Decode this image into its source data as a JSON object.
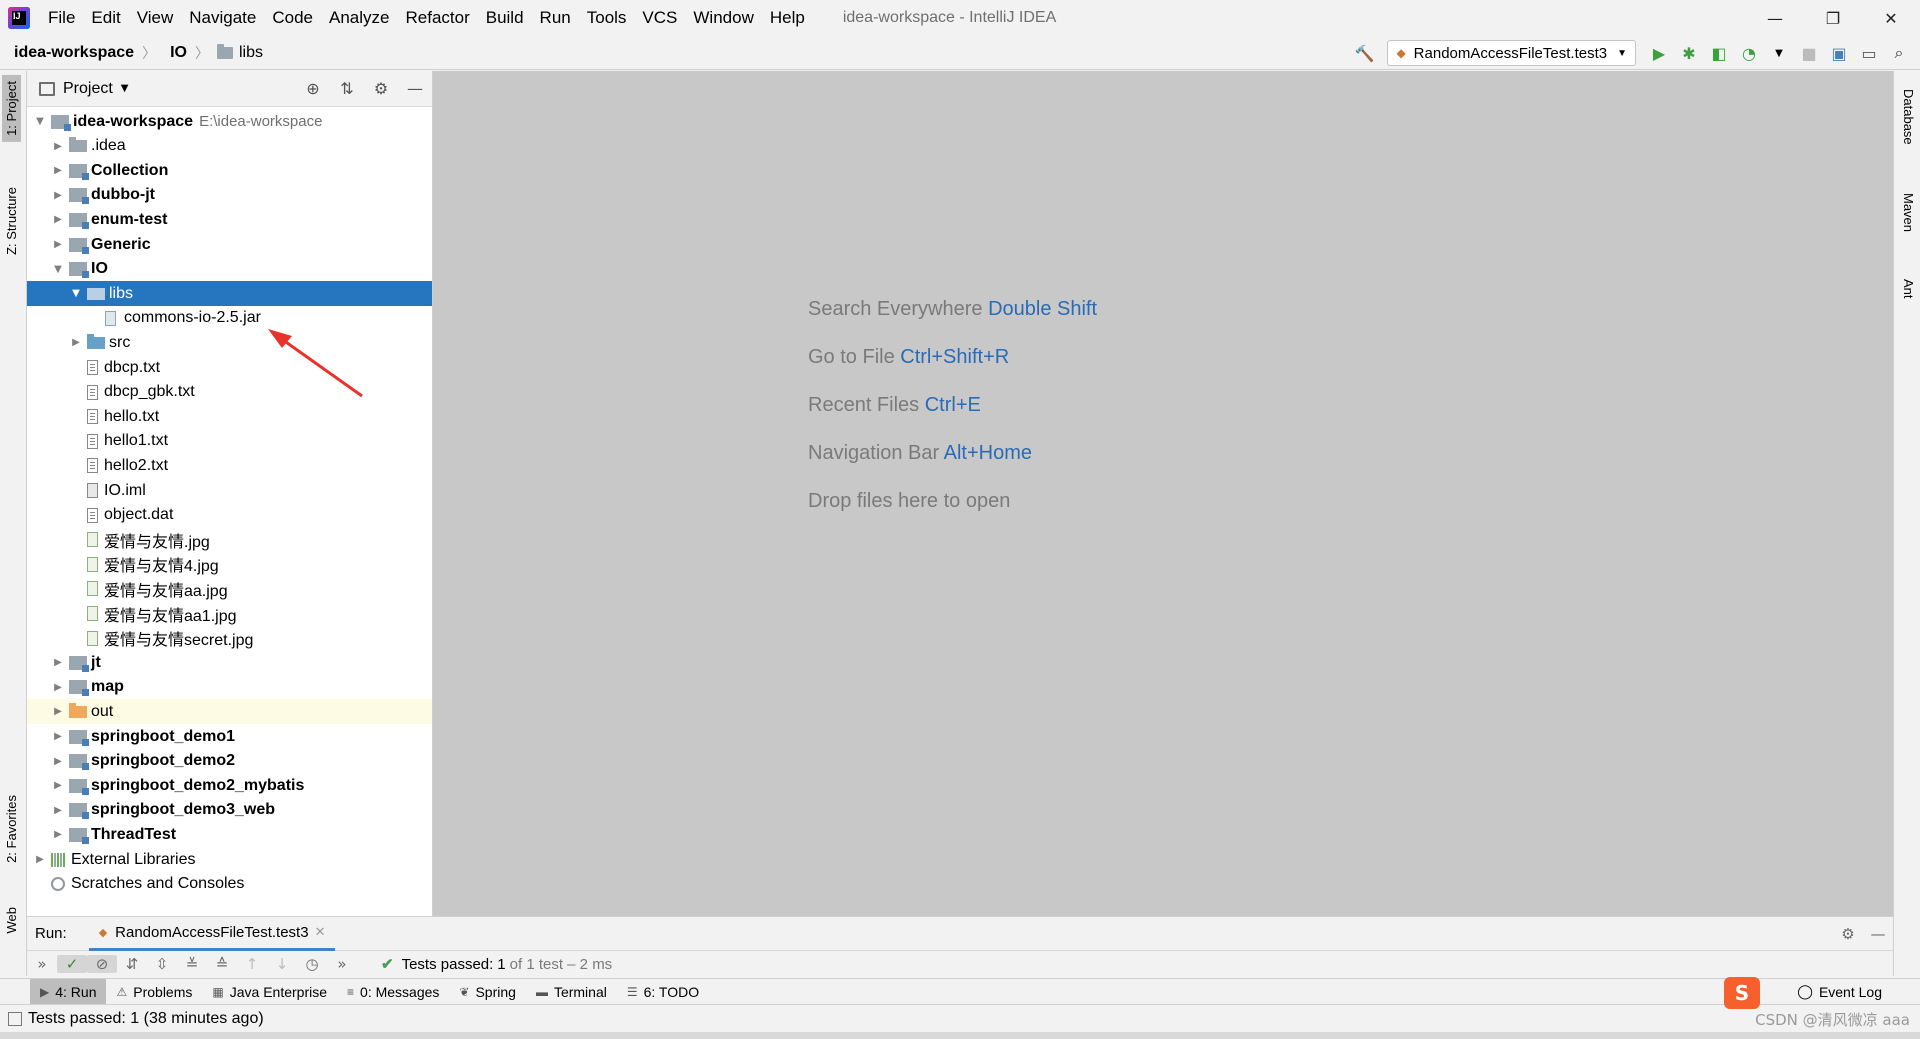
{
  "app": {
    "window_title": "idea-workspace - IntelliJ IDEA",
    "logo_text": "IJ"
  },
  "menu": [
    "File",
    "Edit",
    "View",
    "Navigate",
    "Code",
    "Analyze",
    "Refactor",
    "Build",
    "Run",
    "Tools",
    "VCS",
    "Window",
    "Help"
  ],
  "window_controls": {
    "minimize": "—",
    "maximize": "❐",
    "close": "✕"
  },
  "breadcrumb": {
    "project": "idea-workspace",
    "module": "IO",
    "folder": "libs"
  },
  "run_config": {
    "name": "RandomAccessFileTest.test3"
  },
  "left_stripe": {
    "project_tab": "1: Project",
    "structure_tab": "Z: Structure",
    "favorites_tab": "2: Favorites",
    "web_tab": "Web"
  },
  "right_stripe": {
    "database_tab": "Database",
    "maven_tab": "Maven",
    "ant_tab": "Ant"
  },
  "project_panel": {
    "title": "Project",
    "tree": [
      {
        "label": "idea-workspace",
        "path": "E:\\idea-workspace",
        "type": "module",
        "depth": 0,
        "arrow": "▼",
        "bold": true
      },
      {
        "label": ".idea",
        "type": "folder",
        "depth": 1,
        "arrow": "▶",
        "bold": false
      },
      {
        "label": "Collection",
        "type": "module",
        "depth": 1,
        "arrow": "▶",
        "bold": true
      },
      {
        "label": "dubbo-jt",
        "type": "module",
        "depth": 1,
        "arrow": "▶",
        "bold": true
      },
      {
        "label": "enum-test",
        "type": "module",
        "depth": 1,
        "arrow": "▶",
        "bold": true
      },
      {
        "label": "Generic",
        "type": "module",
        "depth": 1,
        "arrow": "▶",
        "bold": true
      },
      {
        "label": "IO",
        "type": "module",
        "depth": 1,
        "arrow": "▼",
        "bold": true
      },
      {
        "label": "libs",
        "type": "folder-libs",
        "depth": 2,
        "arrow": "▼",
        "bold": false,
        "selected": true
      },
      {
        "label": "commons-io-2.5.jar",
        "type": "jar",
        "depth": 3,
        "arrow": "",
        "bold": false
      },
      {
        "label": "src",
        "type": "folder-src",
        "depth": 2,
        "arrow": "▶",
        "bold": false
      },
      {
        "label": "dbcp.txt",
        "type": "file",
        "depth": 2,
        "arrow": "",
        "bold": false
      },
      {
        "label": "dbcp_gbk.txt",
        "type": "file",
        "depth": 2,
        "arrow": "",
        "bold": false
      },
      {
        "label": "hello.txt",
        "type": "file",
        "depth": 2,
        "arrow": "",
        "bold": false
      },
      {
        "label": "hello1.txt",
        "type": "file",
        "depth": 2,
        "arrow": "",
        "bold": false
      },
      {
        "label": "hello2.txt",
        "type": "file",
        "depth": 2,
        "arrow": "",
        "bold": false
      },
      {
        "label": "IO.iml",
        "type": "iml",
        "depth": 2,
        "arrow": "",
        "bold": false
      },
      {
        "label": "object.dat",
        "type": "file",
        "depth": 2,
        "arrow": "",
        "bold": false
      },
      {
        "label": "爱情与友情.jpg",
        "type": "img",
        "depth": 2,
        "arrow": "",
        "bold": false
      },
      {
        "label": "爱情与友情4.jpg",
        "type": "img",
        "depth": 2,
        "arrow": "",
        "bold": false
      },
      {
        "label": "爱情与友情aa.jpg",
        "type": "img",
        "depth": 2,
        "arrow": "",
        "bold": false
      },
      {
        "label": "爱情与友情aa1.jpg",
        "type": "img",
        "depth": 2,
        "arrow": "",
        "bold": false
      },
      {
        "label": "爱情与友情secret.jpg",
        "type": "img",
        "depth": 2,
        "arrow": "",
        "bold": false
      },
      {
        "label": "jt",
        "type": "module",
        "depth": 1,
        "arrow": "▶",
        "bold": true
      },
      {
        "label": "map",
        "type": "module",
        "depth": 1,
        "arrow": "▶",
        "bold": true
      },
      {
        "label": "out",
        "type": "folder-out",
        "depth": 1,
        "arrow": "▶",
        "bold": false,
        "yellow": true
      },
      {
        "label": "springboot_demo1",
        "type": "module",
        "depth": 1,
        "arrow": "▶",
        "bold": true
      },
      {
        "label": "springboot_demo2",
        "type": "module",
        "depth": 1,
        "arrow": "▶",
        "bold": true
      },
      {
        "label": "springboot_demo2_mybatis",
        "type": "module",
        "depth": 1,
        "arrow": "▶",
        "bold": true
      },
      {
        "label": "springboot_demo3_web",
        "type": "module",
        "depth": 1,
        "arrow": "▶",
        "bold": true
      },
      {
        "label": "ThreadTest",
        "type": "module",
        "depth": 1,
        "arrow": "▶",
        "bold": true
      },
      {
        "label": "External Libraries",
        "type": "lib",
        "depth": 0,
        "arrow": "▶",
        "bold": false
      },
      {
        "label": "Scratches and Consoles",
        "type": "scratch",
        "depth": 0,
        "arrow": "",
        "bold": false
      }
    ]
  },
  "editor_hints": [
    {
      "text": "Search Everywhere",
      "key": "Double Shift"
    },
    {
      "text": "Go to File",
      "key": "Ctrl+Shift+R"
    },
    {
      "text": "Recent Files",
      "key": "Ctrl+E"
    },
    {
      "text": "Navigation Bar",
      "key": "Alt+Home"
    },
    {
      "text": "Drop files here to open",
      "key": ""
    }
  ],
  "run_panel": {
    "label": "Run:",
    "tab": "RandomAccessFileTest.test3",
    "status_prefix": "Tests passed:",
    "status_count": "1",
    "status_suffix": "of 1 test – 2 ms"
  },
  "tool_tabs": [
    {
      "label": "4: Run",
      "icon": "run-icon",
      "active": true
    },
    {
      "label": "Problems",
      "icon": "problems-icon",
      "active": false
    },
    {
      "label": "Java Enterprise",
      "icon": "java-enterprise-icon",
      "active": false
    },
    {
      "label": "0: Messages",
      "icon": "messages-icon",
      "active": false
    },
    {
      "label": "Spring",
      "icon": "spring-icon",
      "active": false
    },
    {
      "label": "Terminal",
      "icon": "terminal-icon",
      "active": false
    },
    {
      "label": "6: TODO",
      "icon": "todo-icon",
      "active": false
    }
  ],
  "event_log": "Event Log",
  "status_bar": {
    "text": "Tests passed: 1 (38 minutes ago)",
    "watermark": "CSDN @清风微凉 aaa",
    "ime": "S"
  },
  "colors": {
    "selection": "#2675bf",
    "editor_bg": "#c8c8c8",
    "accent_key": "#2a6bb5",
    "pass": "#499c54",
    "arrow_annotation": "#e8322b"
  }
}
